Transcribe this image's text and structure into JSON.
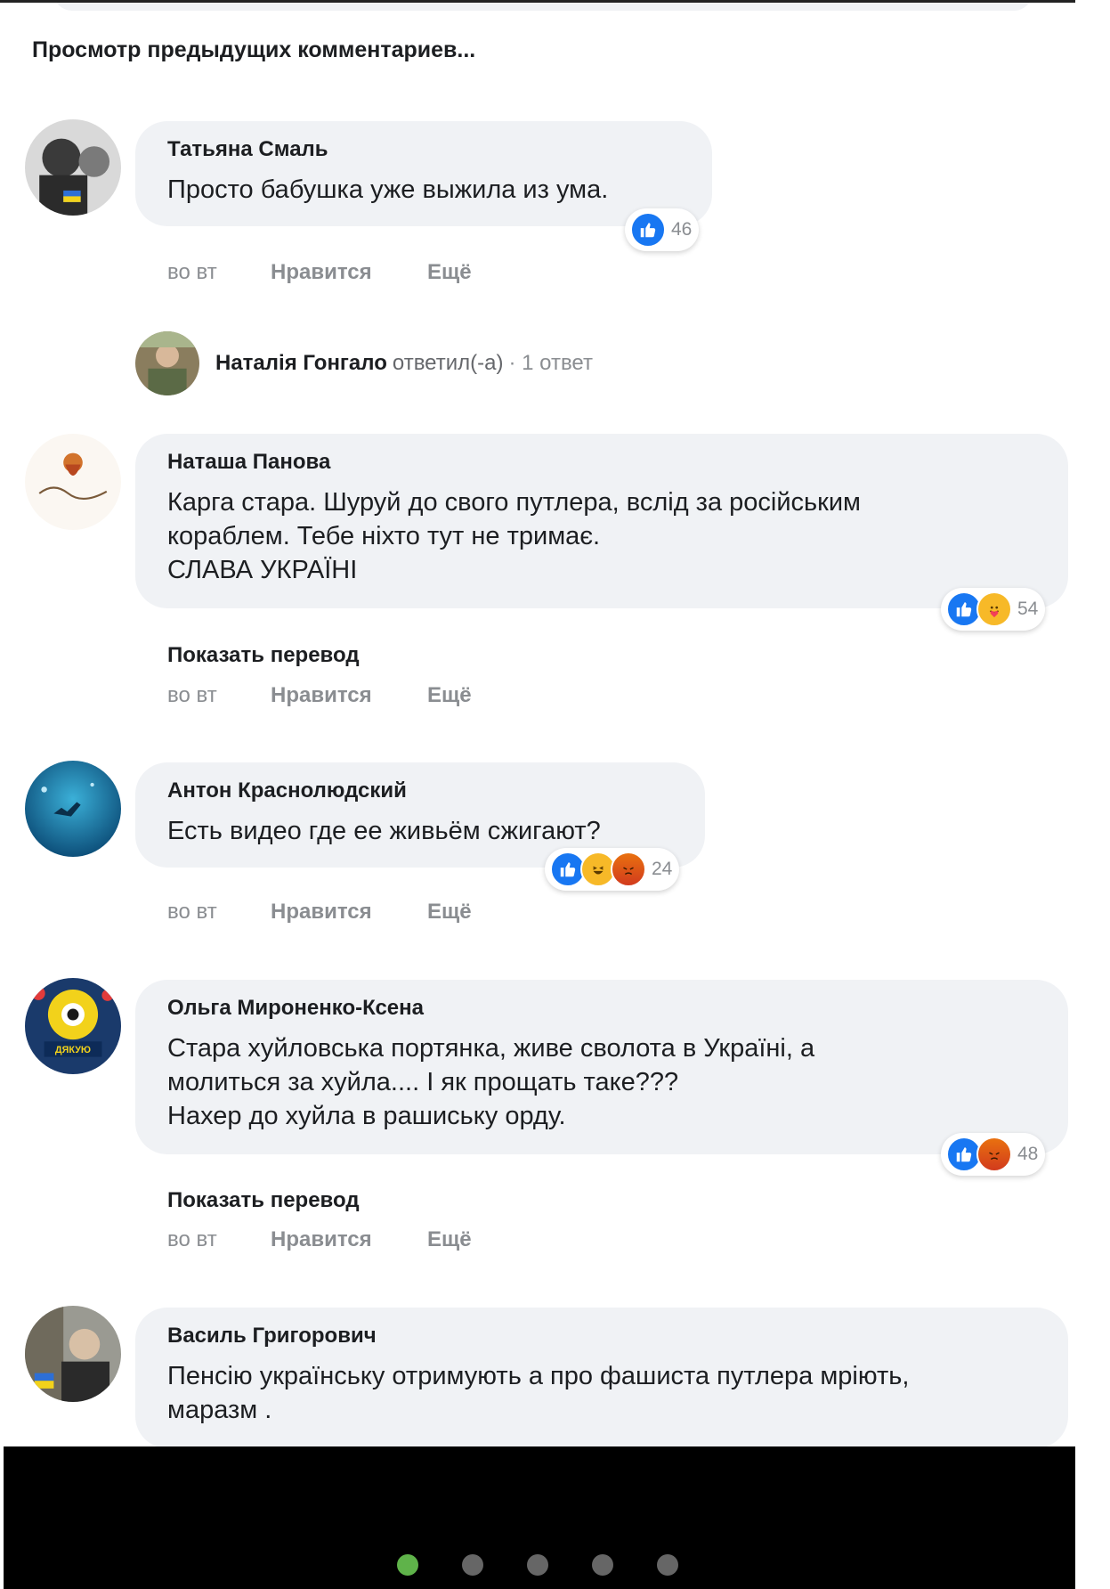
{
  "header": {
    "previous_comments": "Просмотр предыдущих комментариев..."
  },
  "colors": {
    "like": "#1877f2",
    "bubble": "#f0f2f5",
    "active_dot": "#5fb34a"
  },
  "actions": {
    "time": "во вт",
    "like": "Нравится",
    "more": "Ещё"
  },
  "show_translation": "Показать перевод",
  "comments": [
    {
      "author": "Татьяна Смаль",
      "text": [
        "Просто бабушка уже выжила из ума."
      ],
      "reactions": [
        "like"
      ],
      "reaction_count": "46"
    },
    {
      "author": "Наташа Панова",
      "text": [
        "Карга стара. Шуруй до свого путлера, вслід за російським",
        "кораблем. Тебе ніхто тут не тримає.",
        "СЛАВА УКРАЇНІ"
      ],
      "reactions": [
        "like",
        "care"
      ],
      "reaction_count": "54"
    },
    {
      "author": "Антон Краснолюдский",
      "text": [
        "Есть видео где ее живьём сжигают?"
      ],
      "reactions": [
        "like",
        "haha",
        "angry"
      ],
      "reaction_count": "24"
    },
    {
      "author": "Ольга Мироненко-Ксена",
      "text": [
        "Стара хуйловська портянка, живе сволота в Україні, а",
        "молиться за хуйла.... І як прощать таке???",
        "Нахер до хуйла в рашиську орду."
      ],
      "reactions": [
        "like",
        "angry"
      ],
      "reaction_count": "48"
    },
    {
      "author": "Василь Григорович",
      "text": [
        "Пенсію українську отримують а про фашиста путлера мріють,",
        "маразм ."
      ]
    }
  ],
  "reply": {
    "name": "Наталія Гонгало",
    "verb": "ответил(-а)",
    "count": "· 1 ответ"
  },
  "avatar_badges": {
    "olga": "ДЯКУЮ"
  },
  "pager": {
    "pages": 5,
    "active": 1
  }
}
